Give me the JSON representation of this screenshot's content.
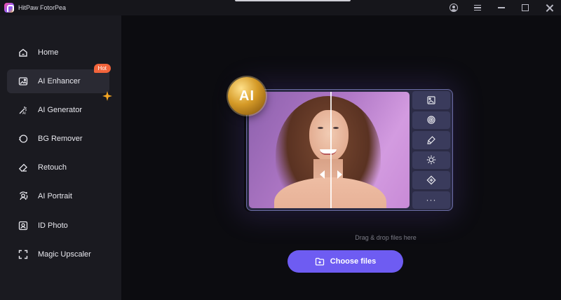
{
  "app": {
    "title": "HitPaw FotorPea"
  },
  "titlebar": {
    "icons": [
      "user-icon",
      "menu-icon",
      "minimize-icon",
      "maximize-icon",
      "close-icon"
    ]
  },
  "sidebar": {
    "items": [
      {
        "label": "Home",
        "icon": "home-icon",
        "active": false
      },
      {
        "label": "AI Enhancer",
        "icon": "image-enhance-icon",
        "active": true,
        "badge": "Hot"
      },
      {
        "label": "AI Generator",
        "icon": "magic-wand-icon",
        "active": false,
        "extra_icon": "sparkle-icon"
      },
      {
        "label": "BG Remover",
        "icon": "bg-remover-icon",
        "active": false
      },
      {
        "label": "Retouch",
        "icon": "eraser-icon",
        "active": false
      },
      {
        "label": "AI Portrait",
        "icon": "portrait-icon",
        "active": false
      },
      {
        "label": "ID Photo",
        "icon": "id-photo-icon",
        "active": false
      },
      {
        "label": "Magic Upscaler",
        "icon": "upscale-icon",
        "active": false
      }
    ]
  },
  "main": {
    "ai_badge": "AI",
    "tools": [
      "image-icon",
      "denoise-icon",
      "brush-icon",
      "brightness-icon",
      "repair-icon",
      "more-icon"
    ],
    "more_label": "···",
    "drop_hint": "Drag & drop files here",
    "choose_button": "Choose files"
  },
  "colors": {
    "accent": "#6e5cf2",
    "hot_badge": "#f2643b",
    "sidebar_bg": "#1a1a20",
    "main_bg": "#0c0c10"
  }
}
